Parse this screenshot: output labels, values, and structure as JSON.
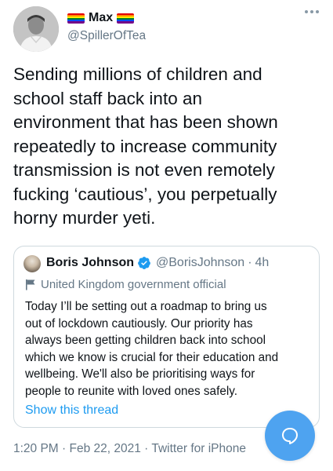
{
  "author": {
    "display_name": "Max",
    "handle": "@SpillerOfTea",
    "avatar_icon": "profile-photo",
    "flag_icon": "rainbow-pride-flag",
    "flag_colors": [
      "#e40303",
      "#ff8c00",
      "#ffed00",
      "#008026",
      "#004dff",
      "#750787"
    ]
  },
  "tweet": {
    "text": "Sending millions of children and\nschool staff back into an\nenvironment that has been shown\nrepeatedly to increase community\ntransmission is not even remotely\nfucking ‘cautious’, you perpetually\nhorny murder yeti.",
    "timestamp": "1:20 PM · Feb 22, 2021",
    "dot": "·",
    "source": "Twitter for iPhone"
  },
  "quoted_tweet": {
    "display_name": "Boris Johnson",
    "verified_icon": "verified-badge-icon",
    "handle": "@BorisJohnson",
    "dot": "·",
    "time": "4h",
    "label_icon": "flag-icon",
    "label": "United Kingdom government official",
    "text": "Today I’ll be setting out a roadmap to bring us\nout of lockdown cautiously. Our priority has\nalways been getting children back into school\nwhich we know is crucial for their education and\nwellbeing. We'll also be prioritising ways for\npeople to reunite with loved ones safely.",
    "show_thread": "Show this thread"
  },
  "colors": {
    "accent": "#1d9bf0",
    "fab": "#4ea3f0",
    "secondary_text": "#657786",
    "border": "#cfd9de"
  },
  "fab": {
    "icon": "reply-bubble-icon"
  }
}
